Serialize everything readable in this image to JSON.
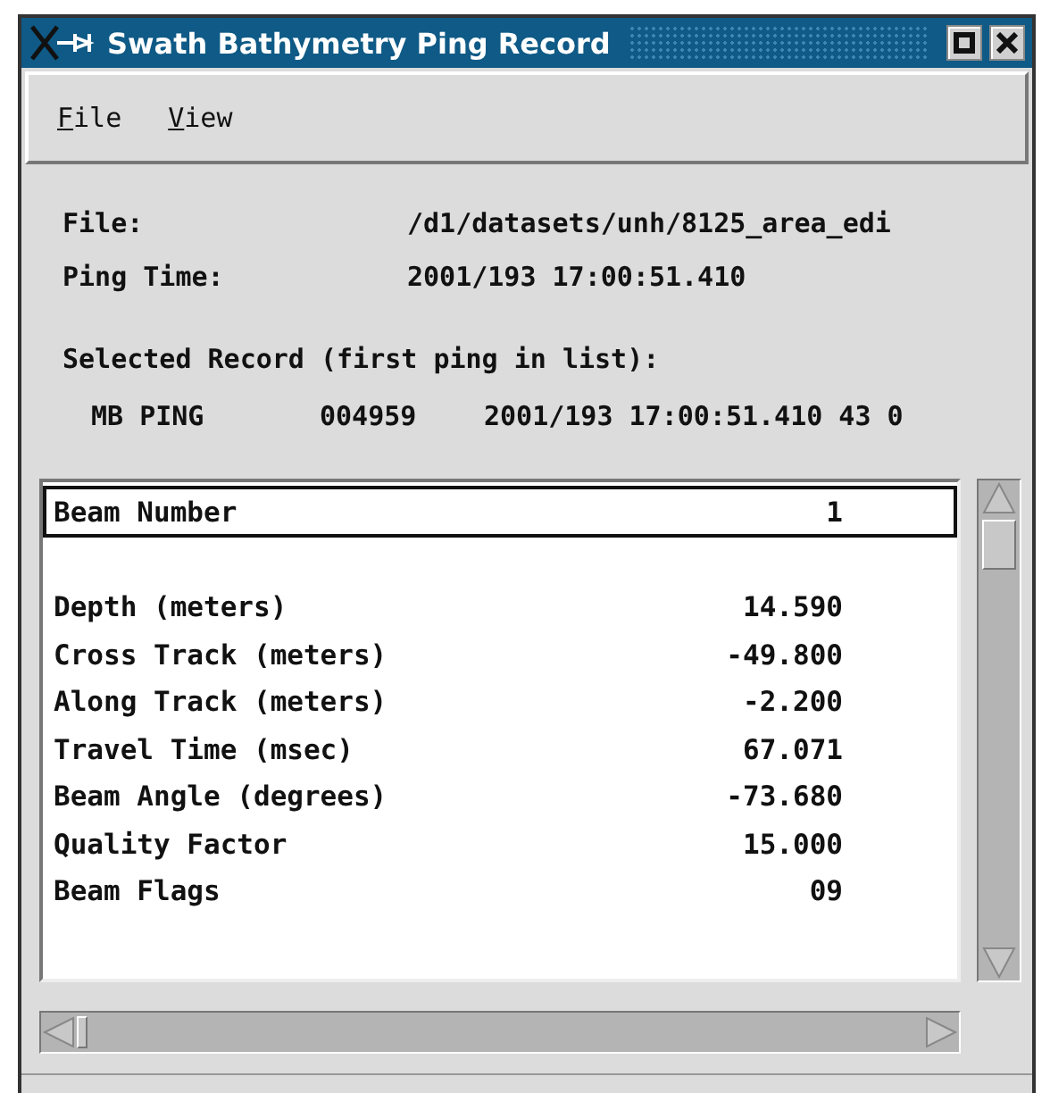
{
  "window": {
    "title": "Swath Bathymetry Ping Record"
  },
  "menu": [
    {
      "label": "File"
    },
    {
      "label": "View"
    }
  ],
  "info": [
    {
      "label": "File:",
      "value": "/d1/datasets/unh/8125_area_edi"
    },
    {
      "label": "Ping Time:",
      "value": "2001/193 17:00:51.410"
    }
  ],
  "selected_record": {
    "label": "Selected Record (first ping in list):",
    "fields": [
      "MB PING",
      "004959",
      "2001/193 17:00:51.410 43 0"
    ]
  },
  "list": [
    {
      "kind": "field",
      "label": "Beam Number",
      "value": "1",
      "selected": true
    },
    {
      "kind": "spacer"
    },
    {
      "kind": "field",
      "label": "Depth (meters)",
      "value": "14.590",
      "selected": false
    },
    {
      "kind": "field",
      "label": "Cross Track (meters)",
      "value": "-49.800",
      "selected": false
    },
    {
      "kind": "field",
      "label": "Along Track (meters)",
      "value": "-2.200",
      "selected": false
    },
    {
      "kind": "field",
      "label": "Travel Time (msec)",
      "value": "67.071",
      "selected": false
    },
    {
      "kind": "field",
      "label": "Beam Angle (degrees)",
      "value": "-73.680",
      "selected": false
    },
    {
      "kind": "field",
      "label": "Quality Factor",
      "value": "15.000",
      "selected": false
    },
    {
      "kind": "field",
      "label": "Beam Flags",
      "value": "09",
      "selected": false
    }
  ]
}
